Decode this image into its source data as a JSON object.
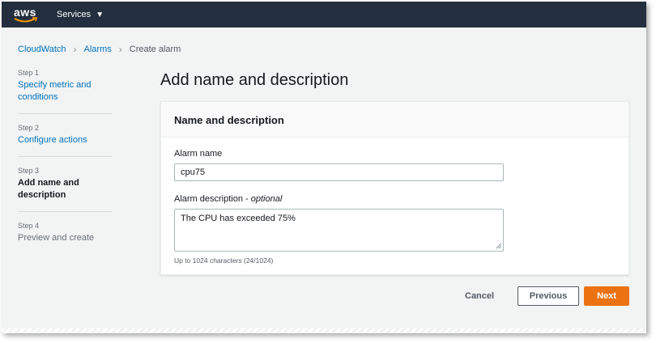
{
  "header": {
    "logo_text": "aws",
    "services_label": "Services"
  },
  "breadcrumb": {
    "items": [
      "CloudWatch",
      "Alarms"
    ],
    "current": "Create alarm"
  },
  "steps": [
    {
      "number": "Step 1",
      "label": "Specify metric and conditions",
      "state": "link"
    },
    {
      "number": "Step 2",
      "label": "Configure actions",
      "state": "link"
    },
    {
      "number": "Step 3",
      "label": "Add name and description",
      "state": "active"
    },
    {
      "number": "Step 4",
      "label": "Preview and create",
      "state": "disabled"
    }
  ],
  "page_title": "Add name and description",
  "panel": {
    "title": "Name and description",
    "alarm_name_label": "Alarm name",
    "alarm_name_value": "cpu75",
    "alarm_description_label": "Alarm description - ",
    "alarm_description_optional": "optional",
    "alarm_description_value": "The CPU has exceeded 75%",
    "hint": "Up to 1024 characters (24/1024)"
  },
  "actions": {
    "cancel": "Cancel",
    "previous": "Previous",
    "next": "Next"
  },
  "colors": {
    "topbar": "#232f3e",
    "link": "#0073bb",
    "primary_button": "#ec7211"
  }
}
